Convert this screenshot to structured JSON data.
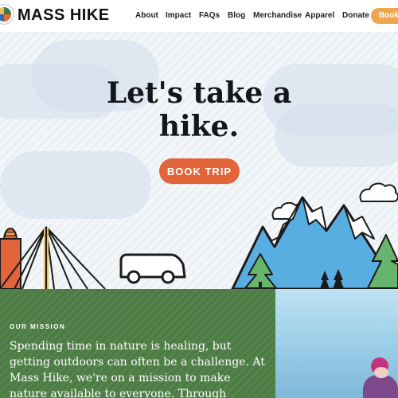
{
  "header": {
    "brand": "MASS HIKE",
    "nav": [
      "About",
      "Impact",
      "FAQs",
      "Blog",
      "Merchandise",
      "Apparel",
      "Donate"
    ],
    "cta": "Book"
  },
  "hero": {
    "title_line1": "Let's take a",
    "title_line2": "hike.",
    "button": "BOOK TRIP"
  },
  "mission": {
    "kicker": "OUR MISSION",
    "body": "Spending time in nature is healing, but getting outdoors can often be a challenge. At Mass Hike, we're on a mission to make nature available to everyone. Through affordable"
  },
  "colors": {
    "accent": "#e2643b",
    "book_header": "#f1a44b",
    "mission_green": "#4d7d45",
    "sky_blue": "#58aee0"
  },
  "icons": {
    "logo": "mass-hike-logo-icon"
  }
}
